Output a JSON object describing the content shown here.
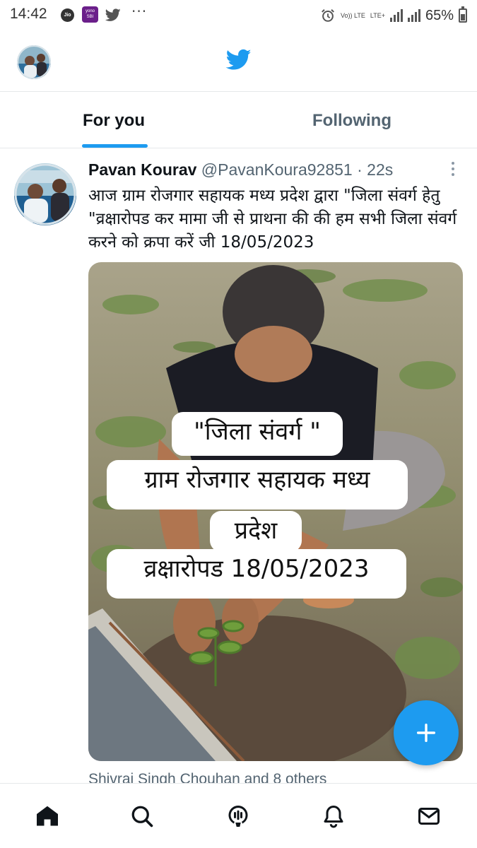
{
  "status_bar": {
    "time": "14:42",
    "carrier_badge": "Jio",
    "app_badge": "yono SBI",
    "overflow": "···",
    "volte": "Vo)) LTE",
    "network": "LTE+",
    "battery": "65%"
  },
  "header": {
    "logo": "twitter-bird-icon",
    "accent_color": "#1d9bf0"
  },
  "tabs": [
    {
      "label": "For you",
      "active": true
    },
    {
      "label": "Following",
      "active": false
    }
  ],
  "tweet": {
    "author_name": "Pavan Kourav",
    "handle": "@PavanKoura92851",
    "separator": " · ",
    "time_ago": "22s",
    "text": "आज ग्राम रोजगार सहायक मध्य प्रदेश द्वारा \"जिला संवर्ग हेतु \"व्रक्षारोपड कर मामा जी से प्राथना की की हम सभी जिला संवर्ग करने को क्रपा करें जी 18/05/2023",
    "media_caption": {
      "line1": "\"जिला संवर्ग \"",
      "line2": "ग्राम रोजगार सहायक मध्य",
      "line3": "प्रदेश",
      "line4": "व्रक्षारोपड 18/05/2023"
    },
    "social_context": "Shivraj Singh Chouhan and 8 others"
  },
  "fab": {
    "icon": "plus-icon"
  },
  "bottom_nav": [
    {
      "name": "home",
      "icon": "home-icon"
    },
    {
      "name": "search",
      "icon": "search-icon"
    },
    {
      "name": "spaces",
      "icon": "spaces-icon"
    },
    {
      "name": "notifications",
      "icon": "bell-icon"
    },
    {
      "name": "messages",
      "icon": "mail-icon"
    }
  ]
}
